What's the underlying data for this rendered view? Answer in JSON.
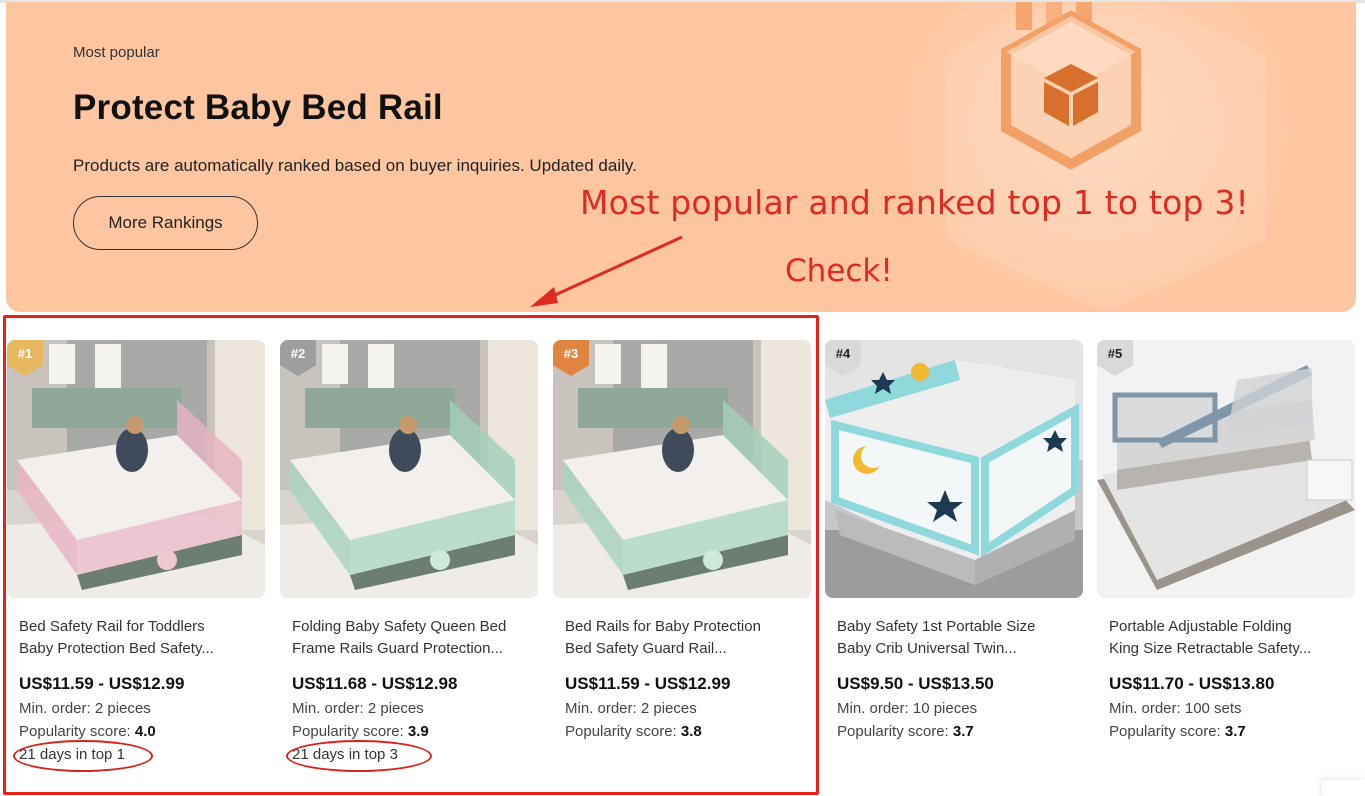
{
  "banner": {
    "eyebrow": "Most popular",
    "title": "Protect Baby Bed Rail",
    "subtitle": "Products are automatically ranked based on buyer inquiries. Updated daily.",
    "more_button": "More Rankings",
    "icon": "medal-box-icon",
    "background_color": "#fec6a0"
  },
  "annotations": {
    "headline": "Most popular and ranked top 1 to top 3!",
    "check": "Check!",
    "color": "#e0291f"
  },
  "products": [
    {
      "rank": "#1",
      "badge_color": "#e8b860",
      "image": "pink-bed-rail-photo",
      "name_line1": "Bed Safety Rail for Toddlers",
      "name_line2": "Baby Protection Bed Safety...",
      "price": "US$11.59 - US$12.99",
      "min_order": "Min. order: 2 pieces",
      "popularity_label": "Popularity score:",
      "popularity_value": "4.0",
      "days_in_top": "21 days in top 1"
    },
    {
      "rank": "#2",
      "badge_color": "#9e9e9e",
      "image": "mint-bed-rail-photo",
      "name_line1": "Folding Baby Safety Queen Bed",
      "name_line2": "Frame Rails Guard Protection...",
      "price": "US$11.68 - US$12.98",
      "min_order": "Min. order: 2 pieces",
      "popularity_label": "Popularity score:",
      "popularity_value": "3.9",
      "days_in_top": "21 days in top 3"
    },
    {
      "rank": "#3",
      "badge_color": "#e0843e",
      "image": "mint-bed-rail-photo",
      "name_line1": "Bed Rails for Baby Protection",
      "name_line2": "Bed Safety Guard Rail...",
      "price": "US$11.59 - US$12.99",
      "min_order": "Min. order: 2 pieces",
      "popularity_label": "Popularity score:",
      "popularity_value": "3.8"
    },
    {
      "rank": "#4",
      "badge_color": "#d9d9d9",
      "image": "blue-star-moon-bed-rail-photo",
      "name_line1": "Baby Safety 1st Portable Size",
      "name_line2": "Baby Crib Universal Twin...",
      "price": "US$9.50 - US$13.50",
      "min_order": "Min. order: 10 pieces",
      "popularity_label": "Popularity score:",
      "popularity_value": "3.7"
    },
    {
      "rank": "#5",
      "badge_color": "#d9d9d9",
      "image": "grey-retractable-bed-rail-photo",
      "name_line1": "Portable Adjustable Folding",
      "name_line2": "King Size Retractable Safety...",
      "price": "US$11.70 - US$13.80",
      "min_order": "Min. order: 100 sets",
      "popularity_label": "Popularity score:",
      "popularity_value": "3.7"
    }
  ]
}
